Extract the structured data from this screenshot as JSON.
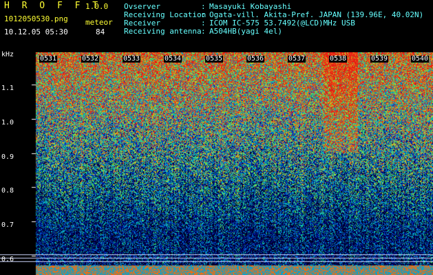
{
  "header": {
    "app_title": "H R O F F T",
    "app_version": "1.0.0",
    "file_name": "1012050530.png",
    "timestamp": "10.12.05 05:30",
    "meteor_label": "meteor",
    "meteor_count": "84"
  },
  "info": [
    {
      "label": "Ovserver",
      "value": "Masayuki Kobayashi"
    },
    {
      "label": "Receiving Location",
      "value": "Ogata-vill. Akita-Pref. JAPAN (139.96E, 40.02N)"
    },
    {
      "label": "Receiver",
      "value": "ICOM IC-575 53.7492(@LCD)MHz USB"
    },
    {
      "label": "Receiving antenna",
      "value": "A504HB(yagi 4el)"
    }
  ],
  "separator": ":",
  "spectrogram": {
    "y_unit": "kHz",
    "y_ticks": [
      "1.1",
      "1.0",
      "0.9",
      "0.8",
      "0.7",
      "0.6"
    ],
    "time_ticks": [
      "0531",
      "0532",
      "0533",
      "0534",
      "0535",
      "0536",
      "0537",
      "0538",
      "0539",
      "0540"
    ]
  },
  "colors": {
    "header_text": "#ffff33",
    "info_text": "#66ffff",
    "background": "#000000"
  }
}
